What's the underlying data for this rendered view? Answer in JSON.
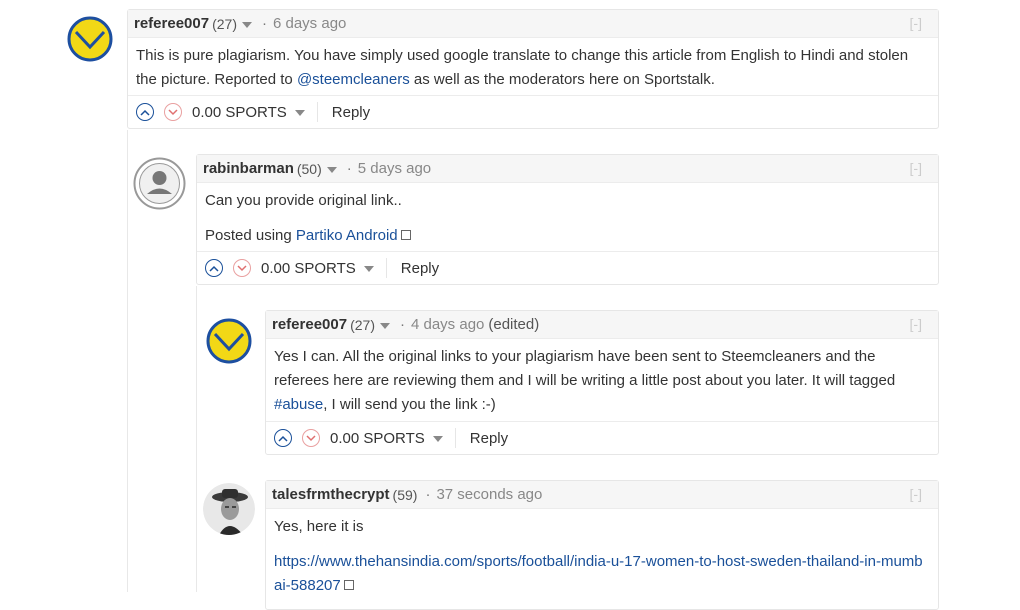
{
  "comments": [
    {
      "author": "referee007",
      "reputation": "(27)",
      "time": "6 days ago",
      "edited": "",
      "collapse": "[-]",
      "body": [
        "This is pure plagiarism. You have simply used google translate to change this article from English to Hindi and stolen the picture. Reported to ",
        "@steemcleaners",
        " as well as the moderators here on Sportstalk."
      ],
      "payout": "0.00 SPORTS",
      "reply": "Reply"
    },
    {
      "author": "rabinbarman",
      "reputation": "(50)",
      "time": "5 days ago",
      "collapse": "[-]",
      "body_line1": "Can you provide original link..",
      "body_line2_prefix": "Posted using ",
      "body_line2_link": "Partiko Android",
      "payout": "0.00 SPORTS",
      "reply": "Reply"
    },
    {
      "author": "referee007",
      "reputation": "(27)",
      "time": "4 days ago",
      "edited": "(edited)",
      "collapse": "[-]",
      "body_prefix": "Yes I can. All the original links to your plagiarism have been sent to Steemcleaners and the referees here are reviewing them and I will be writing a little post about you later. It will tagged ",
      "body_tag": "#abuse",
      "body_suffix": ", I will send you the link :-)",
      "payout": "0.00 SPORTS",
      "reply": "Reply"
    },
    {
      "author": "talesfrmthecrypt",
      "reputation": "(59)",
      "time": "37 seconds ago",
      "collapse": "[-]",
      "body_line1": "Yes, here it is",
      "body_link": "https://www.thehansindia.com/sports/football/india-u-17-women-to-host-sweden-thailand-in-mumbai-588207"
    }
  ],
  "icons": {
    "upvote": "chevron-up-circle-icon",
    "downvote": "chevron-down-circle-icon",
    "external": "external-link-icon",
    "dropdown": "caret-down-icon"
  },
  "colors": {
    "link": "#1a5099",
    "avatar_yellow": "#f2d816",
    "avatar_blue": "#1d4fa0",
    "upvote": "#1a5099",
    "downvote": "#e9a0a0"
  }
}
